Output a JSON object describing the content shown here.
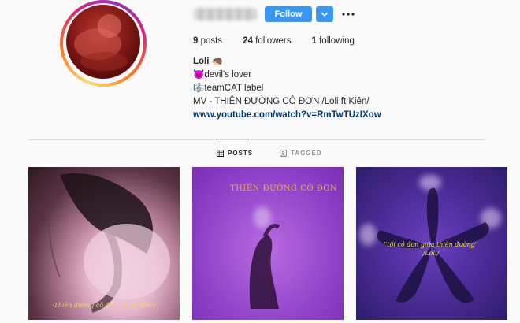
{
  "profile": {
    "follow_label": "Follow",
    "stats": {
      "posts_count": "9",
      "posts_label": "posts",
      "followers_count": "24",
      "followers_label": "followers",
      "following_count": "1",
      "following_label": "following"
    },
    "bio": {
      "name": "Loli",
      "name_emoji": "🦔",
      "line1": "😈devil's lover",
      "line2": "🎼teamCAT label",
      "line3": "MV - THIÊN ĐƯỜNG CÔ ĐƠN /Loli ft Kiên/",
      "link": "www.youtube.com/watch?v=RmTwTUzIXow"
    }
  },
  "tabs": [
    {
      "label": "POSTS",
      "icon": "grid-icon",
      "active": true
    },
    {
      "label": "TAGGED",
      "icon": "tag-icon",
      "active": false
    }
  ],
  "posts": [
    {
      "caption": "-Thiên đường cô đơn - /Loli-Kiên/"
    },
    {
      "caption": "THIÊN ĐƯỜNG CÔ ĐƠN"
    },
    {
      "caption": "\"tôi cô đơn giữa thiên đường\" /Loli/"
    }
  ],
  "colors": {
    "accent_blue": "#3897f0",
    "link_blue": "#00376b",
    "text": "#262626",
    "muted": "#8e8e8e"
  }
}
